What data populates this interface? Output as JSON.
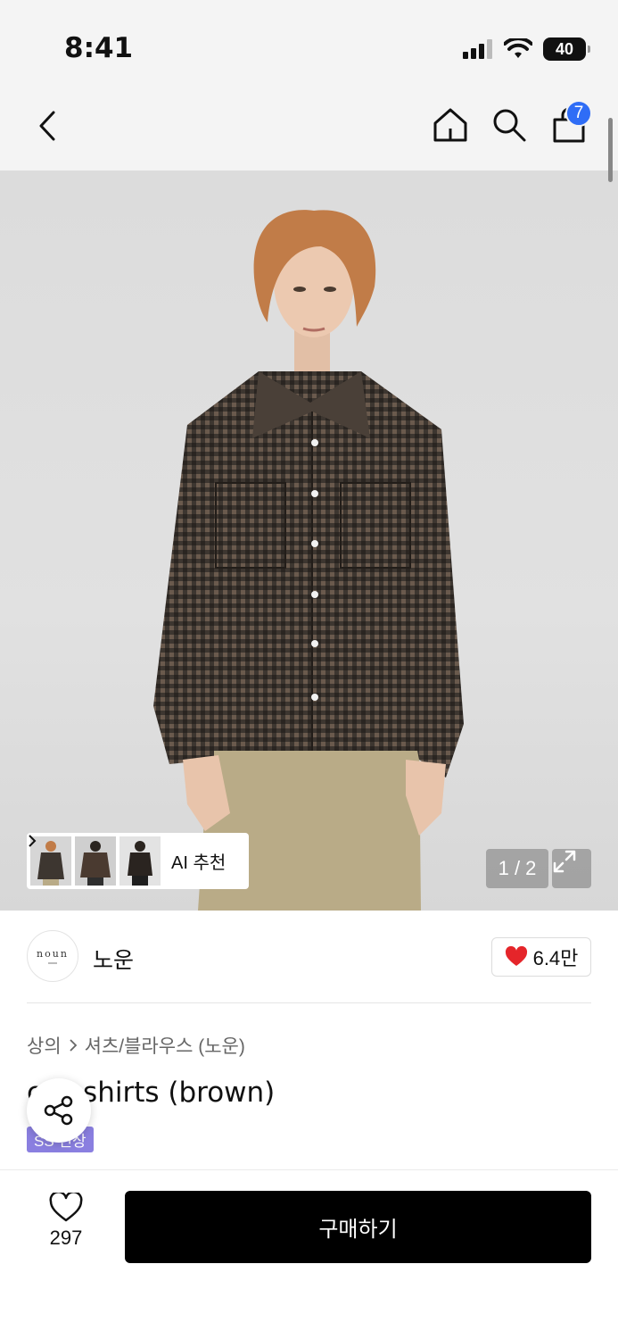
{
  "status_bar": {
    "time": "8:41",
    "battery": "40"
  },
  "nav": {
    "icons": [
      "back-icon",
      "home-icon",
      "search-icon",
      "cart-icon"
    ],
    "cart_count": "7"
  },
  "hero": {
    "ai_recommend_label": "AI 추천",
    "page_indicator": "1 / 2"
  },
  "brand": {
    "logo_text": "noun",
    "name": "노운",
    "likes": "6.4만"
  },
  "product": {
    "breadcrumb": [
      "상의",
      "셔츠/블라우스 (노운)"
    ],
    "title_visible": "shirts (brown)",
    "title_prefix_partial": "c",
    "season_badge": "SS 신상"
  },
  "bottom_bar": {
    "wish_count": "297",
    "buy_label": "구매하기"
  },
  "colors": {
    "accent_blue": "#2f6df6",
    "heart_red": "#e5252a",
    "badge_purple": "#8a7fe0",
    "buy_black": "#000000"
  }
}
